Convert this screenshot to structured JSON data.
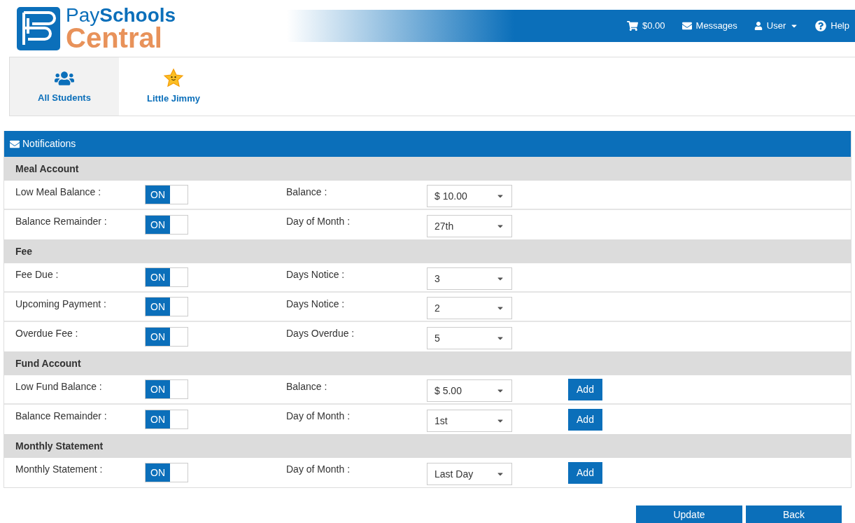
{
  "logo": {
    "line1_light": "Pay",
    "line1_bold": "Schools",
    "line2": "Central"
  },
  "topbar": [
    {
      "kind": "cart",
      "label": "$0.00"
    },
    {
      "kind": "mail",
      "label": "Messages"
    },
    {
      "kind": "user",
      "label": "User"
    },
    {
      "kind": "help",
      "label": "Help"
    }
  ],
  "students": [
    {
      "kind": "group",
      "name": "All Students",
      "selected": true
    },
    {
      "kind": "star",
      "name": "Little Jimmy",
      "selected": false
    }
  ],
  "panel": {
    "title": "Notifications",
    "sections": [
      {
        "title": "Meal Account",
        "rows": [
          {
            "label": "Low Meal Balance :",
            "toggle": {
              "text": "ON",
              "on": true
            },
            "setting": "Balance :",
            "value": "$ 10.00"
          },
          {
            "label": "Balance Remainder :",
            "toggle": {
              "text": "ON",
              "on": true
            },
            "setting": "Day of Month :",
            "value": "27th"
          }
        ]
      },
      {
        "title": "Fee",
        "rows": [
          {
            "label": "Fee Due :",
            "toggle": {
              "text": "ON",
              "on": true
            },
            "setting": "Days Notice :",
            "value": "3"
          },
          {
            "label": "Upcoming Payment :",
            "toggle": {
              "text": "ON",
              "on": true
            },
            "setting": "Days Notice :",
            "value": "2"
          },
          {
            "label": "Overdue Fee :",
            "toggle": {
              "text": "ON",
              "on": true
            },
            "setting": "Days Overdue :",
            "value": "5"
          }
        ]
      },
      {
        "title": "Fund Account",
        "rows": [
          {
            "label": "Low Fund Balance :",
            "toggle": {
              "text": "ON",
              "on": true
            },
            "setting": "Balance :",
            "value": "$ 5.00",
            "action": "Add"
          },
          {
            "label": "Balance Remainder :",
            "toggle": {
              "text": "ON",
              "on": true
            },
            "setting": "Day of Month :",
            "value": "1st",
            "action": "Add"
          }
        ]
      },
      {
        "title": "Monthly Statement",
        "rows": [
          {
            "label": "Monthly Statement :",
            "toggle": {
              "text": "ON",
              "on": true
            },
            "setting": "Day of Month :",
            "value": "Last Day",
            "action": "Add"
          }
        ]
      }
    ]
  },
  "buttons": [
    "Update",
    "Back"
  ]
}
